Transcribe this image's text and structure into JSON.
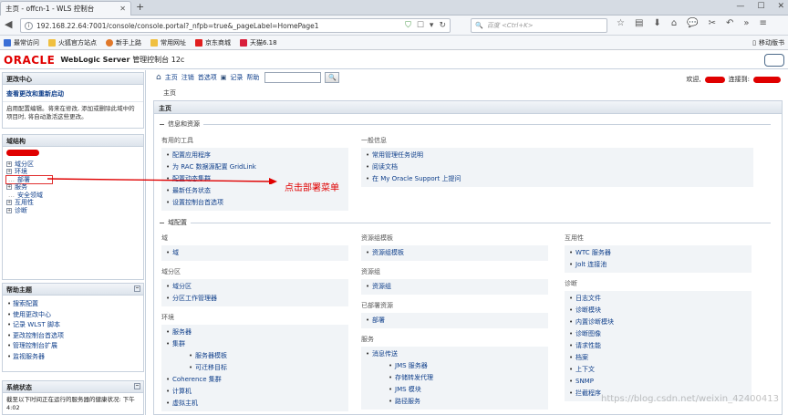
{
  "browser": {
    "tab_title": "主页 - offcn-1 - WLS 控制台",
    "url": "192.168.22.64:7001/console/console.portal?_nfpb=true&_pageLabel=HomePage1",
    "search_placeholder": "百度 <Ctrl+K>",
    "bookmarks": [
      {
        "label": "最常访问",
        "color": "#3b6fd6"
      },
      {
        "label": "火狐官方站点",
        "color": "#f0c040"
      },
      {
        "label": "新手上路",
        "color": "#e0782a"
      },
      {
        "label": "常用网址",
        "color": "#f0c040"
      },
      {
        "label": "京东商城",
        "color": "#e01e1e"
      },
      {
        "label": "天猫6.18",
        "color": "#d81e3a"
      }
    ],
    "mobile_bookmarks": "移动版书"
  },
  "header": {
    "logo": "ORACLE",
    "product": "WebLogic Server",
    "product_sub": "管理控制台 12c"
  },
  "left": {
    "change_center": {
      "title": "更改中心",
      "link": "查看更改和重新启动",
      "text": "启用配置编辑。将来在修改, 添加或删除此域中的项目时, 将自动激活这些更改。"
    },
    "domain_structure": {
      "title": "域结构",
      "items": [
        {
          "label": "域分区",
          "toggle": "+"
        },
        {
          "label": "环境",
          "toggle": "+"
        },
        {
          "label": "部署",
          "toggle": ""
        },
        {
          "label": "服务",
          "toggle": "+"
        },
        {
          "label": "安全领域",
          "toggle": ""
        },
        {
          "label": "互用性",
          "toggle": "+"
        },
        {
          "label": "诊断",
          "toggle": "+"
        }
      ]
    },
    "help": {
      "title": "帮助主题",
      "items": [
        "搜索配置",
        "使用更改中心",
        "记录 WLST 脚本",
        "更改控制台首选项",
        "管理控制台扩展",
        "监视服务器"
      ]
    },
    "system_status": {
      "title": "系统状态",
      "text": "截至以下时间正在运行的服务器的健康状况: 下午4:02"
    }
  },
  "main": {
    "toolbar": [
      "主页",
      "注销",
      "首选项",
      "记录",
      "帮助"
    ],
    "search_button": "🔍",
    "welcome": "欢迎,",
    "connected": "连接到:",
    "breadcrumb": "主页",
    "content_title": "主页",
    "section1": "信息和资源",
    "section2": "域配置",
    "useful_tools": {
      "title": "有用的工具",
      "links": [
        "配置应用程序",
        "为 RAC 数据源配置 GridLink",
        "配置动态集群",
        "最新任务状态",
        "设置控制台首选项"
      ]
    },
    "general_info": {
      "title": "一般信息",
      "links": [
        "常用管理任务说明",
        "阅读文档",
        "在 My Oracle Support 上提问"
      ]
    },
    "col1": [
      {
        "title": "域",
        "links": [
          {
            "t": "域",
            "sub": false
          }
        ]
      },
      {
        "title": "域分区",
        "links": [
          {
            "t": "域分区",
            "sub": false
          },
          {
            "t": "分区工作管理器",
            "sub": false
          }
        ]
      },
      {
        "title": "环境",
        "links": [
          {
            "t": "服务器",
            "sub": false
          },
          {
            "t": "集群",
            "sub": false
          },
          {
            "t": "服务器模板",
            "sub": true
          },
          {
            "t": "可迁移目标",
            "sub": true
          },
          {
            "t": "Coherence 集群",
            "sub": false
          },
          {
            "t": "计算机",
            "sub": false
          },
          {
            "t": "虚拟主机",
            "sub": false
          }
        ]
      }
    ],
    "col2": [
      {
        "title": "资源组模板",
        "links": [
          {
            "t": "资源组模板",
            "sub": false
          }
        ]
      },
      {
        "title": "资源组",
        "links": [
          {
            "t": "资源组",
            "sub": false
          }
        ]
      },
      {
        "title": "已部署资源",
        "links": [
          {
            "t": "部署",
            "sub": false
          }
        ]
      },
      {
        "title": "服务",
        "links": [
          {
            "t": "消息传送",
            "sub": false
          },
          {
            "t": "JMS 服务器",
            "sub": true
          },
          {
            "t": "存储转发代理",
            "sub": true
          },
          {
            "t": "JMS 模块",
            "sub": true
          },
          {
            "t": "路径服务",
            "sub": true
          }
        ]
      }
    ],
    "col3": [
      {
        "title": "互用性",
        "links": [
          {
            "t": "WTC 服务器",
            "sub": false
          },
          {
            "t": "Jolt 连接池",
            "sub": false
          }
        ]
      },
      {
        "title": "诊断",
        "links": [
          {
            "t": "日志文件",
            "sub": false
          },
          {
            "t": "诊断模块",
            "sub": false
          },
          {
            "t": "内置诊断模块",
            "sub": false
          },
          {
            "t": "诊断图像",
            "sub": false
          },
          {
            "t": "请求性能",
            "sub": false
          },
          {
            "t": "档案",
            "sub": false
          },
          {
            "t": "上下文",
            "sub": false
          },
          {
            "t": "SNMP",
            "sub": false
          },
          {
            "t": "拦截程序",
            "sub": false
          }
        ]
      }
    ]
  },
  "annotation": "点击部署菜单",
  "watermark": "https://blog.csdn.net/weixin_42400413"
}
